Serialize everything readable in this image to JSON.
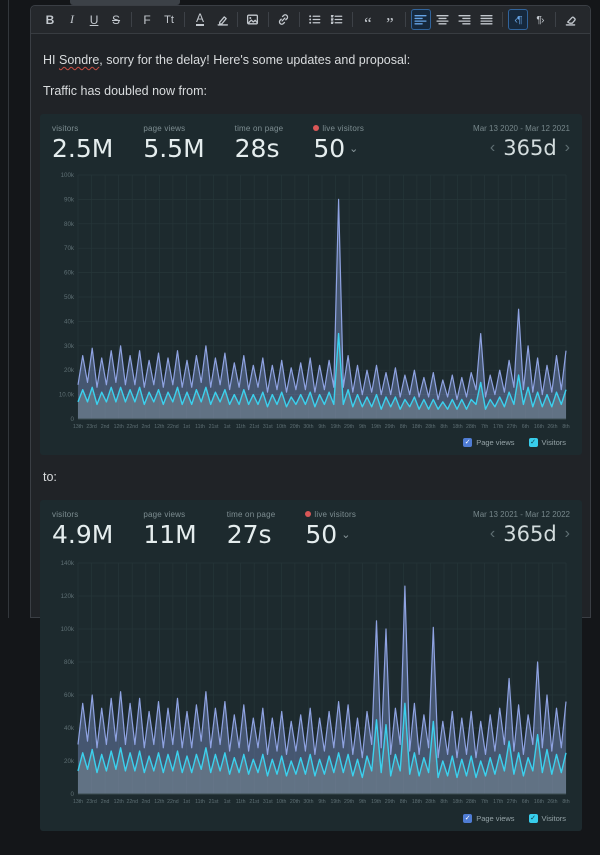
{
  "editor": {
    "p1_prefix": "HI ",
    "p1_misspelled": "Sondre",
    "p1_suffix": ", sorry for the delay! Here's some updates and proposal:",
    "p2": "Traffic has doubled now from:",
    "p3": "to:"
  },
  "toolbar": {
    "groups": [
      {
        "items": [
          {
            "name": "bold",
            "glyph": "B"
          },
          {
            "name": "italic",
            "glyph": "I"
          },
          {
            "name": "underline",
            "glyph": "U"
          },
          {
            "name": "strikethrough",
            "glyph": "S"
          }
        ]
      },
      {
        "items": [
          {
            "name": "font",
            "glyph": "F"
          },
          {
            "name": "text-size",
            "glyph": "Tt"
          }
        ]
      },
      {
        "items": [
          {
            "name": "text-color",
            "glyph": "A"
          },
          {
            "name": "highlight",
            "svg": "highlight"
          }
        ]
      },
      {
        "items": [
          {
            "name": "image",
            "svg": "image"
          }
        ]
      },
      {
        "items": [
          {
            "name": "link",
            "svg": "link"
          }
        ]
      },
      {
        "items": [
          {
            "name": "bullet-list",
            "svg": "bullet-list"
          },
          {
            "name": "numbered-list",
            "svg": "numbered-list"
          }
        ]
      },
      {
        "items": [
          {
            "name": "quote-open",
            "glyph": "“"
          },
          {
            "name": "quote-close",
            "glyph": "”"
          }
        ]
      },
      {
        "items": [
          {
            "name": "align-left",
            "svg": "align-left",
            "active": true
          },
          {
            "name": "align-center",
            "svg": "align-center"
          },
          {
            "name": "align-right",
            "svg": "align-right"
          },
          {
            "name": "align-justify",
            "svg": "align-justify"
          }
        ]
      },
      {
        "items": [
          {
            "name": "paragraph-ltr",
            "glyph": "‹¶",
            "active": true
          },
          {
            "name": "paragraph-rtl",
            "glyph": "¶›"
          }
        ]
      },
      {
        "items": [
          {
            "name": "clear-format",
            "svg": "clear-format"
          }
        ]
      }
    ]
  },
  "dashboards": [
    {
      "stats": [
        {
          "label": "visitors",
          "value": "2.5M"
        },
        {
          "label": "page views",
          "value": "5.5M"
        },
        {
          "label": "time on page",
          "value": "28s"
        },
        {
          "label": "live visitors",
          "value": "50",
          "live": true,
          "dropdown": true
        }
      ],
      "date_range": "Mar 13 2020 - Mar 12 2021",
      "period": "365d",
      "prev_chevron": "‹",
      "next_chevron": "›"
    },
    {
      "stats": [
        {
          "label": "visitors",
          "value": "4.9M"
        },
        {
          "label": "page views",
          "value": "11M"
        },
        {
          "label": "time on page",
          "value": "27s"
        },
        {
          "label": "live visitors",
          "value": "50",
          "live": true,
          "dropdown": true
        }
      ],
      "date_range": "Mar 13 2021 - Mar 12 2022",
      "period": "365d",
      "prev_chevron": "‹",
      "next_chevron": "›"
    }
  ],
  "legend": [
    {
      "label": "Page views",
      "color": "#4f7cd4",
      "check": "✓",
      "check_color": "#ffffff"
    },
    {
      "label": "Visitors",
      "color": "#38cdeb",
      "check": "✓",
      "check_color": "#0e3540"
    }
  ],
  "colors": {
    "dashboard_bg": "#1d2a2e",
    "grid": "#263639",
    "axis": "#3c4c50",
    "tick_label": "#5e6f74",
    "page_views_line": "#8fa3e2",
    "page_views_fill": "rgba(127,147,205,0.42)",
    "visitors_line": "#3bd1ee",
    "visitors_fill": "rgba(145,160,165,0.38)",
    "live_dot": "#d95757"
  },
  "chart_data": [
    {
      "type": "area",
      "title": "Traffic Mar 13 2020 - Mar 12 2021",
      "units": "thousands",
      "ylim": [
        0,
        100
      ],
      "yticks": [
        {
          "v": 100,
          "label": "100k"
        },
        {
          "v": 90,
          "label": "90k"
        },
        {
          "v": 80,
          "label": "80k"
        },
        {
          "v": 70,
          "label": "70k"
        },
        {
          "v": 60,
          "label": "60k"
        },
        {
          "v": 50,
          "label": "50k"
        },
        {
          "v": 40,
          "label": "40k"
        },
        {
          "v": 30,
          "label": "30k"
        },
        {
          "v": 20,
          "label": "20k"
        },
        {
          "v": 10,
          "label": "10.0k"
        },
        {
          "v": 0,
          "label": "0"
        }
      ],
      "x_ticks": [
        "13th",
        "23rd",
        "2nd",
        "12th",
        "22nd",
        "2nd",
        "12th",
        "22nd",
        "1st",
        "11th",
        "21st",
        "1st",
        "11th",
        "21st",
        "31st",
        "10th",
        "20th",
        "30th",
        "9th",
        "19th",
        "29th",
        "9th",
        "19th",
        "29th",
        "8th",
        "18th",
        "28th",
        "8th",
        "18th",
        "28th",
        "7th",
        "17th",
        "27th",
        "6th",
        "16th",
        "26th",
        "8th"
      ],
      "series": [
        {
          "name": "Page views",
          "values": [
            14,
            26,
            15,
            29,
            13,
            25,
            14,
            28,
            15,
            30,
            14,
            26,
            14,
            28,
            13,
            24,
            14,
            27,
            13,
            25,
            14,
            28,
            13,
            24,
            13,
            26,
            15,
            30,
            13,
            25,
            14,
            27,
            12,
            23,
            13,
            26,
            12,
            22,
            13,
            25,
            11,
            22,
            12,
            24,
            11,
            21,
            12,
            23,
            12,
            25,
            11,
            22,
            12,
            24,
            13,
            90,
            13,
            26,
            11,
            22,
            10,
            20,
            11,
            22,
            10,
            19,
            10,
            21,
            9,
            18,
            10,
            20,
            9,
            17,
            9,
            19,
            8,
            16,
            9,
            18,
            8,
            17,
            9,
            19,
            12,
            35,
            9,
            18,
            10,
            20,
            11,
            24,
            13,
            45,
            12,
            30,
            11,
            25,
            10,
            22,
            11,
            26,
            12,
            28
          ]
        },
        {
          "name": "Visitors",
          "values": [
            7,
            12,
            7,
            13,
            6,
            11,
            7,
            13,
            7,
            13,
            7,
            12,
            7,
            13,
            6,
            11,
            7,
            12,
            6,
            11,
            7,
            13,
            6,
            11,
            6,
            12,
            7,
            13,
            6,
            11,
            7,
            12,
            6,
            10,
            6,
            12,
            6,
            10,
            6,
            11,
            5,
            10,
            6,
            11,
            5,
            9,
            6,
            10,
            6,
            11,
            5,
            10,
            6,
            11,
            6,
            35,
            6,
            12,
            5,
            10,
            5,
            9,
            5,
            10,
            4,
            9,
            5,
            9,
            4,
            8,
            5,
            9,
            4,
            8,
            4,
            8,
            4,
            7,
            4,
            8,
            4,
            8,
            4,
            8,
            6,
            15,
            4,
            8,
            5,
            9,
            5,
            11,
            6,
            18,
            6,
            13,
            5,
            11,
            5,
            10,
            5,
            11,
            6,
            12
          ]
        }
      ],
      "legend_position": "bottom-right",
      "grid": true
    },
    {
      "type": "area",
      "title": "Traffic Mar 13 2021 - Mar 12 2022",
      "units": "thousands",
      "ylim": [
        0,
        140
      ],
      "yticks": [
        {
          "v": 140,
          "label": "140k"
        },
        {
          "v": 120,
          "label": "120k"
        },
        {
          "v": 100,
          "label": "100k"
        },
        {
          "v": 80,
          "label": "80k"
        },
        {
          "v": 60,
          "label": "60k"
        },
        {
          "v": 40,
          "label": "40k"
        },
        {
          "v": 20,
          "label": "20k"
        },
        {
          "v": 0,
          "label": "0"
        }
      ],
      "x_ticks": [
        "13th",
        "23rd",
        "2nd",
        "12th",
        "22nd",
        "2nd",
        "12th",
        "22nd",
        "1st",
        "11th",
        "21st",
        "1st",
        "11th",
        "21st",
        "31st",
        "10th",
        "20th",
        "30th",
        "9th",
        "19th",
        "29th",
        "9th",
        "19th",
        "29th",
        "8th",
        "18th",
        "28th",
        "8th",
        "18th",
        "28th",
        "7th",
        "17th",
        "27th",
        "6th",
        "16th",
        "26th",
        "8th"
      ],
      "series": [
        {
          "name": "Page views",
          "values": [
            30,
            55,
            32,
            60,
            28,
            52,
            30,
            58,
            32,
            62,
            30,
            55,
            30,
            58,
            28,
            50,
            30,
            56,
            28,
            52,
            30,
            58,
            28,
            50,
            28,
            54,
            32,
            62,
            28,
            52,
            30,
            56,
            26,
            48,
            28,
            54,
            26,
            46,
            28,
            52,
            24,
            46,
            26,
            50,
            24,
            44,
            26,
            48,
            26,
            52,
            24,
            46,
            26,
            50,
            28,
            56,
            28,
            54,
            24,
            46,
            22,
            50,
            30,
            105,
            28,
            100,
            24,
            52,
            30,
            126,
            26,
            55,
            24,
            48,
            28,
            101,
            22,
            44,
            24,
            50,
            22,
            46,
            24,
            50,
            22,
            44,
            24,
            48,
            26,
            52,
            30,
            70,
            26,
            54,
            24,
            48,
            30,
            80,
            28,
            60,
            26,
            52,
            28,
            56
          ]
        },
        {
          "name": "Visitors",
          "values": [
            14,
            25,
            15,
            27,
            13,
            24,
            14,
            26,
            15,
            28,
            14,
            25,
            14,
            26,
            13,
            23,
            14,
            25,
            13,
            24,
            14,
            26,
            13,
            23,
            13,
            24,
            15,
            28,
            13,
            24,
            14,
            25,
            12,
            22,
            13,
            24,
            12,
            21,
            13,
            24,
            11,
            21,
            12,
            23,
            11,
            20,
            12,
            22,
            12,
            24,
            11,
            21,
            12,
            23,
            13,
            25,
            13,
            24,
            11,
            21,
            10,
            23,
            14,
            45,
            13,
            42,
            11,
            24,
            14,
            55,
            12,
            25,
            11,
            22,
            13,
            44,
            10,
            20,
            11,
            23,
            10,
            21,
            11,
            23,
            10,
            20,
            11,
            22,
            12,
            24,
            14,
            32,
            12,
            25,
            11,
            22,
            14,
            36,
            13,
            27,
            12,
            24,
            13,
            25
          ]
        }
      ],
      "legend_position": "bottom-right",
      "grid": true
    }
  ]
}
